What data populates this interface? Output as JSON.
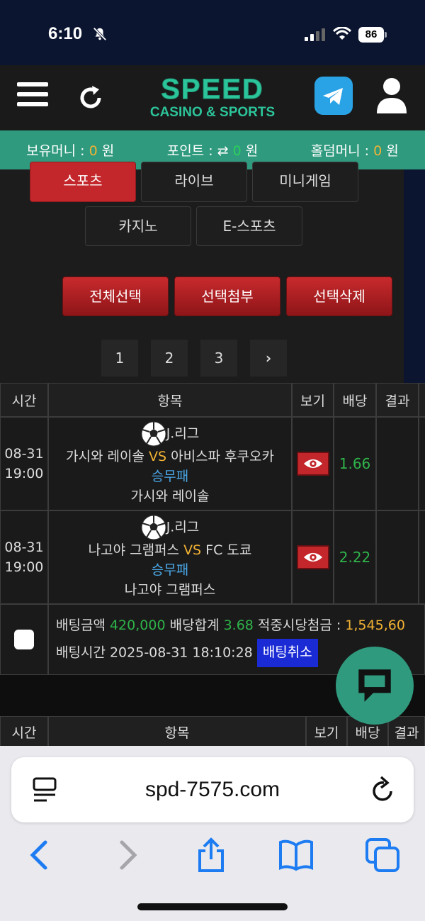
{
  "status": {
    "time": "6:10",
    "battery": "86"
  },
  "header": {
    "logo_main": "SPEED",
    "logo_sub": "CASINO & SPORTS"
  },
  "balance": {
    "money_label": "보유머니 :",
    "money_value": "0",
    "money_unit": "원",
    "point_label": "포인트 :",
    "point_value": "0",
    "point_unit": "원",
    "hold_label": "홀덤머니 :",
    "hold_value": "0",
    "hold_unit": "원"
  },
  "categories": [
    "스포츠",
    "라이브",
    "미니게임",
    "카지노",
    "E-스포츠"
  ],
  "actions": {
    "select_all": "전체선택",
    "attach": "선택첨부",
    "delete": "선택삭제"
  },
  "pagination": [
    "1",
    "2",
    "3"
  ],
  "table": {
    "headers": [
      "시간",
      "항목",
      "보기",
      "배당",
      "결과"
    ],
    "rows": [
      {
        "date": "08-31",
        "time": "19:00",
        "league": "J.리그",
        "home": "가시와 레이솔",
        "vs": "VS",
        "away": "아비스파 후쿠오카",
        "market": "승무패",
        "pick": "가시와 레이솔",
        "odds": "1.66"
      },
      {
        "date": "08-31",
        "time": "19:00",
        "league": "J.리그",
        "home": "나고야 그램퍼스",
        "vs": "VS",
        "away": "FC 도쿄",
        "market": "승무패",
        "pick": "나고야 그램퍼스",
        "odds": "2.22"
      }
    ],
    "summary": {
      "bet_label": "배팅금액",
      "bet_value": "420,000",
      "odds_label": "배당합계",
      "odds_value": "3.68",
      "win_label": "적중시당첨금 :",
      "win_value": "1,545,60",
      "time_label": "배팅시간",
      "time_value": "2025-08-31 18:10:28",
      "cancel": "배팅취소"
    }
  },
  "browser": {
    "url": "spd-7575.com"
  },
  "colors": {
    "accent_green": "#2f9a7e",
    "red": "#c3272b",
    "odds_green": "#2fb34a",
    "orange": "#f2b233",
    "blue": "#4aa8e8"
  }
}
